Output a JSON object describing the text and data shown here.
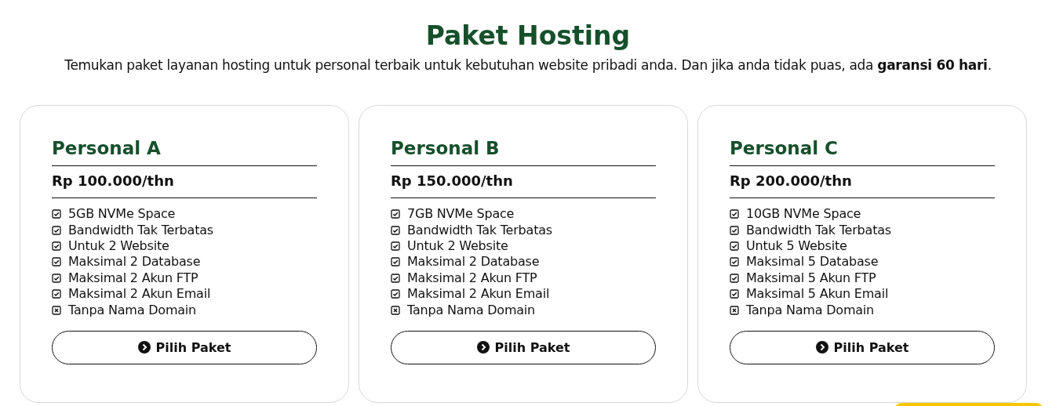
{
  "title": "Paket Hosting",
  "subtitle": "Temukan paket layanan hosting untuk personal terbaik untuk kebutuhan website pribadi anda. Dan jika anda tidak puas, ada **garansi 60 hari**.",
  "plans": [
    {
      "name": "Personal A",
      "price": "Rp 100.000/thn",
      "features": [
        {
          "label": "5GB NVMe Space",
          "included": true
        },
        {
          "label": "Bandwidth Tak Terbatas",
          "included": true
        },
        {
          "label": "Untuk 2 Website",
          "included": true
        },
        {
          "label": "Maksimal 2 Database",
          "included": true
        },
        {
          "label": "Maksimal 2 Akun FTP",
          "included": true
        },
        {
          "label": "Maksimal 2 Akun Email",
          "included": true
        },
        {
          "label": "Tanpa Nama Domain",
          "included": false
        }
      ],
      "button": "Pilih Paket"
    },
    {
      "name": "Personal B",
      "price": "Rp 150.000/thn",
      "features": [
        {
          "label": "7GB NVMe Space",
          "included": true
        },
        {
          "label": "Bandwidth Tak Terbatas",
          "included": true
        },
        {
          "label": "Untuk 2 Website",
          "included": true
        },
        {
          "label": "Maksimal 2 Database",
          "included": true
        },
        {
          "label": "Maksimal 2 Akun FTP",
          "included": true
        },
        {
          "label": "Maksimal 2 Akun Email",
          "included": true
        },
        {
          "label": "Tanpa Nama Domain",
          "included": false
        }
      ],
      "button": "Pilih Paket"
    },
    {
      "name": "Personal C",
      "price": "Rp 200.000/thn",
      "features": [
        {
          "label": "10GB NVMe Space",
          "included": true
        },
        {
          "label": "Bandwidth Tak Terbatas",
          "included": true
        },
        {
          "label": "Untuk 5 Website",
          "included": true
        },
        {
          "label": "Maksimal 5 Database",
          "included": true
        },
        {
          "label": "Maksimal 5 Akun FTP",
          "included": true
        },
        {
          "label": "Maksimal 5 Akun Email",
          "included": true
        },
        {
          "label": "Tanpa Nama Domain",
          "included": false
        }
      ],
      "button": "Pilih Paket"
    }
  ]
}
